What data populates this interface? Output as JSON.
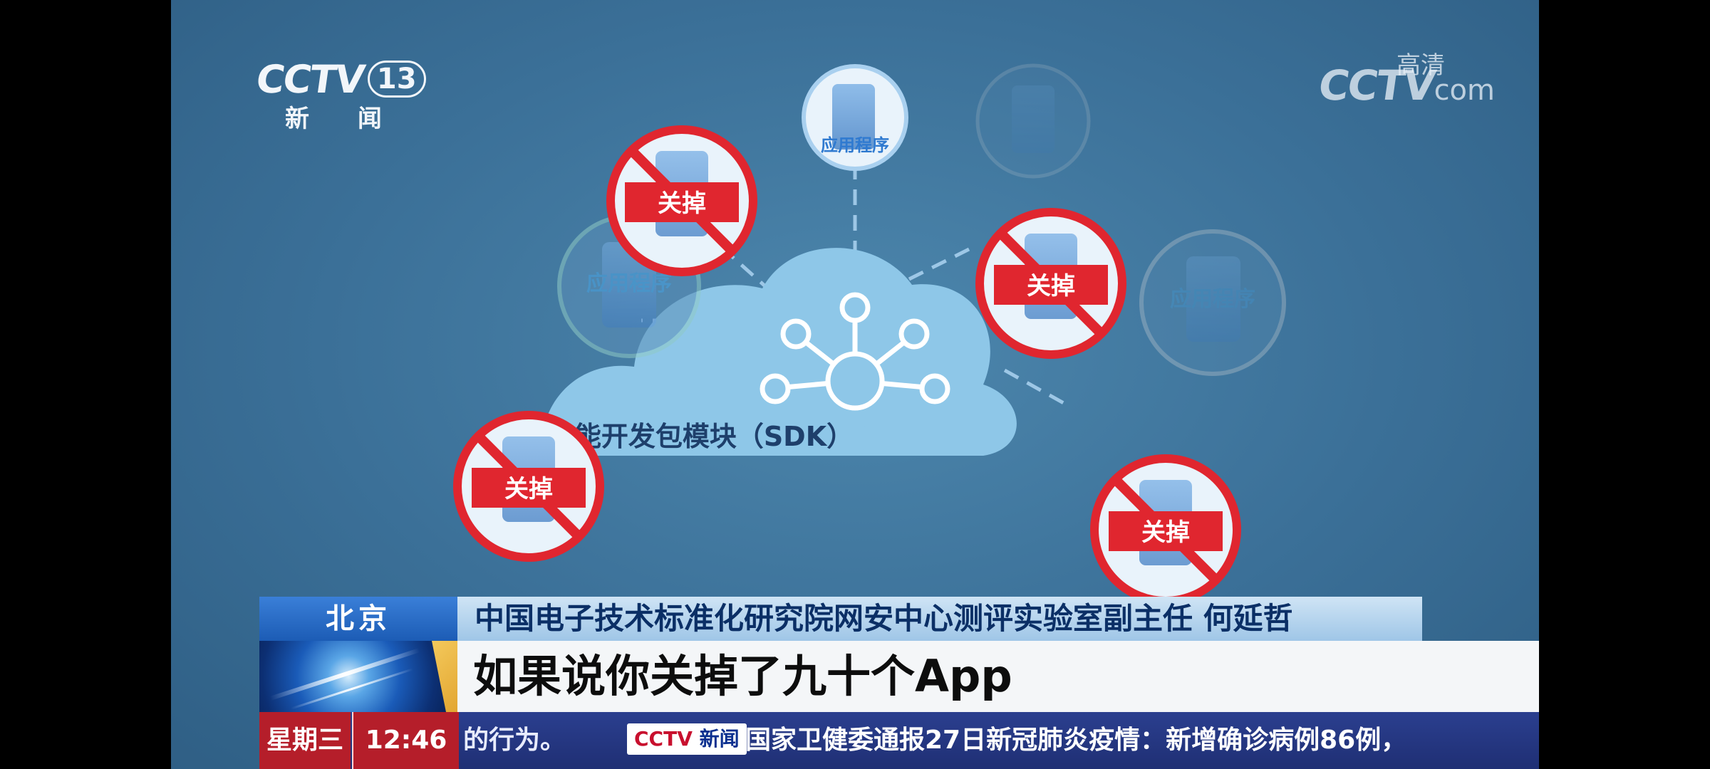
{
  "channel": {
    "brand": "CCTV",
    "number": "13",
    "name": "新 闻",
    "watermark_brand": "CCTV",
    "watermark_domain": "com",
    "watermark_hd": "高清"
  },
  "diagram": {
    "hub_label": "功能开发包模块（SDK）",
    "app_label": "应用程序",
    "closed_label": "关掉"
  },
  "lower_third": {
    "location": "北京",
    "speaker": "中国电子技术标准化研究院网安中心测评实验室副主任 何延哲",
    "subtitle": "如果说你关掉了九十个App",
    "day": "星期三",
    "time": "12:46",
    "ticker_prev": "的行为。",
    "ticker_logo_brand": "CCTV",
    "ticker_logo_name": "新闻",
    "ticker_text": "国家卫健委通报27日新冠肺炎疫情：新增确诊病例86例，"
  },
  "colors": {
    "background": "#3b7098",
    "cloud": "#8ec7e8",
    "prohibit_red": "#e0262f",
    "ticker_blue": "#1f2f74",
    "location_blue": "#1c5cb5"
  }
}
